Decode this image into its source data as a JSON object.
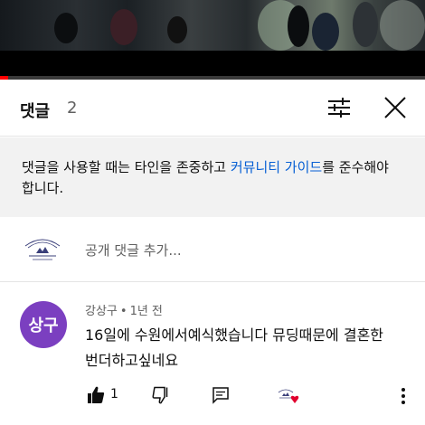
{
  "video": {
    "progress_percent": 2
  },
  "header": {
    "title": "댓글",
    "count": "2"
  },
  "notice": {
    "text_before": "댓글을 사용할 때는 타인을 존중하고 ",
    "link_text": "커뮤니티 가이드",
    "text_after": "를 준수해야 합니다."
  },
  "add_comment": {
    "placeholder": "공개 댓글 추가..."
  },
  "comment": {
    "avatar_text": "상구",
    "avatar_color": "#7b3fc0",
    "author": "강상구",
    "separator": "•",
    "time": "1년 전",
    "text": "16일에 수원에서예식했습니다 뮤딩때문에 결혼한번더하고싶네요",
    "like_count": "1",
    "creator_heart_color": "#e1002d"
  },
  "colors": {
    "link": "#065fd4",
    "progress": "#ff0000",
    "secondary_text": "#606060",
    "notice_bg": "#f2f2f2"
  },
  "icons": [
    "sort-filter-icon",
    "close-icon",
    "thumbs-up-icon",
    "thumbs-down-icon",
    "reply-icon",
    "creator-heart-icon",
    "more-vertical-icon"
  ]
}
